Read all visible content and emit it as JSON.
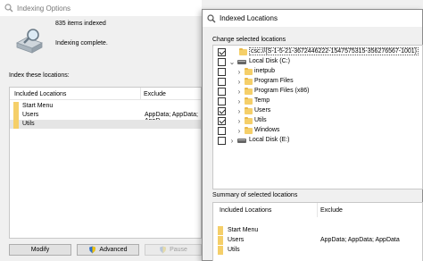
{
  "indexing_options": {
    "title": "Indexing Options",
    "items_indexed": "835 items indexed",
    "status": "Indexing complete.",
    "index_label": "Index these locations:",
    "columns": {
      "included": "Included Locations",
      "exclude": "Exclude"
    },
    "rows": [
      {
        "name": "Start Menu",
        "exclude": ""
      },
      {
        "name": "Users",
        "exclude": "AppData; AppData; AppD"
      },
      {
        "name": "Utils",
        "exclude": ""
      }
    ],
    "buttons": {
      "modify": "Modify",
      "advanced": "Advanced",
      "pause": "Pause"
    }
  },
  "indexed_locations": {
    "title": "Indexed Locations",
    "change_label": "Change selected locations",
    "tree": [
      {
        "label": "csc://{S-1-5-21-3672446222-1547575315-356276567-1001}",
        "checked": true,
        "expander": "",
        "icon": "folder-icon",
        "level": 0
      },
      {
        "label": "Local Disk (C:)",
        "checked": false,
        "expander": "v",
        "icon": "drive-icon",
        "level": 0
      },
      {
        "label": "inetpub",
        "checked": false,
        "expander": ">",
        "icon": "folder-icon",
        "level": 1
      },
      {
        "label": "Program Files",
        "checked": false,
        "expander": ">",
        "icon": "folder-icon",
        "level": 1
      },
      {
        "label": "Program Files (x86)",
        "checked": false,
        "expander": ">",
        "icon": "folder-icon",
        "level": 1
      },
      {
        "label": "Temp",
        "checked": false,
        "expander": ">",
        "icon": "folder-icon",
        "level": 1
      },
      {
        "label": "Users",
        "checked": true,
        "expander": ">",
        "icon": "folder-icon",
        "level": 1
      },
      {
        "label": "Utils",
        "checked": true,
        "expander": ">",
        "icon": "folder-icon",
        "level": 1
      },
      {
        "label": "Windows",
        "checked": false,
        "expander": ">",
        "icon": "folder-icon",
        "level": 1
      },
      {
        "label": "Local Disk (E:)",
        "checked": false,
        "expander": ">",
        "icon": "drive-icon",
        "level": 0
      }
    ],
    "summary_label": "Summary of selected locations",
    "summary_columns": {
      "included": "Included Locations",
      "exclude": "Exclude"
    },
    "summary_rows": [
      {
        "name": "Start Menu",
        "exclude": ""
      },
      {
        "name": "Users",
        "exclude": "AppData; AppData; AppData"
      },
      {
        "name": "Utils",
        "exclude": ""
      }
    ]
  },
  "colors": {
    "folder": "#f5cf69",
    "selection": "#e5e5e5"
  }
}
